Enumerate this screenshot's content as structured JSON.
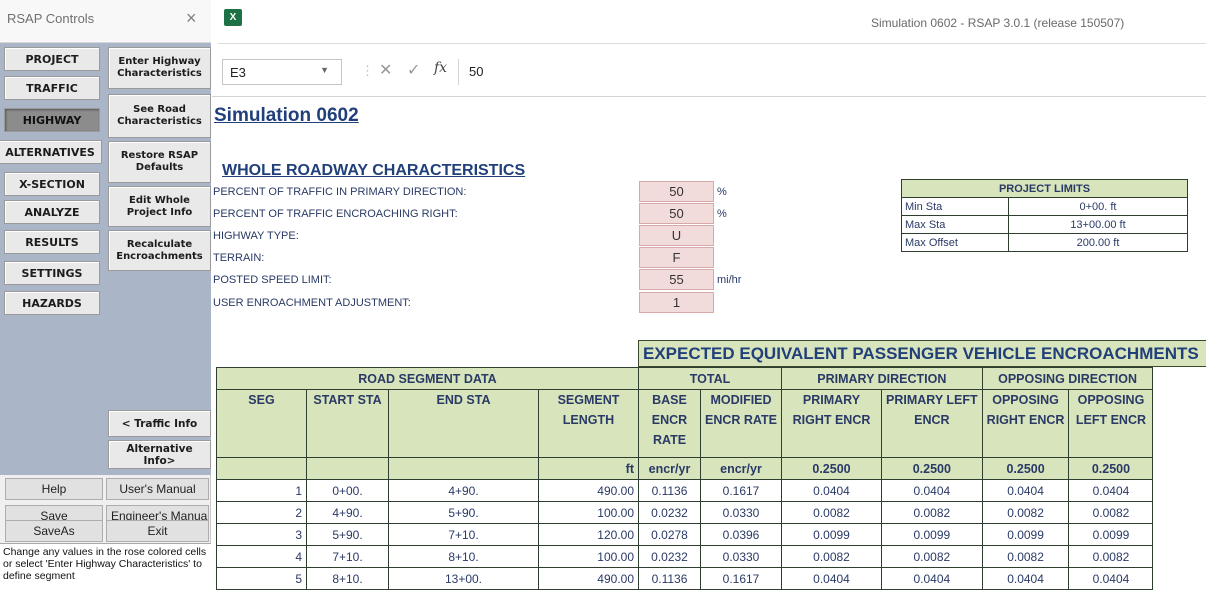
{
  "panel": {
    "title": "RSAP Controls",
    "close": "×",
    "nav": [
      "PROJECT",
      "TRAFFIC",
      "HIGHWAY",
      "ALTERNATIVES",
      "X-SECTION",
      "ANALYZE",
      "RESULTS",
      "SETTINGS",
      "HAZARDS"
    ],
    "active_nav": "HIGHWAY",
    "commands": [
      "Enter Highway Characteristics",
      "See Road Characteristics",
      "Restore RSAP Defaults",
      "Edit Whole Project Info",
      "Recalculate Encroachments"
    ],
    "prev_button": "< Traffic Info",
    "next_button": "Alternative Info>",
    "bottom": {
      "help": "Help",
      "users_manual": "User's Manual",
      "save": "Save",
      "engineers_manual": "Engineer's Manua",
      "saveas": "SaveAs",
      "exit": "Exit"
    },
    "hint": "Change any values in the rose colored cells or select 'Enter Highway Characteristics' to define segment"
  },
  "excel": {
    "app_icon": "excel-icon",
    "window_title": "Simulation 0602 - RSAP 3.0.1 (release 150507)",
    "name_box": "E3",
    "formula_value": "50"
  },
  "sheet": {
    "title": "Simulation 0602",
    "section": "WHOLE ROADWAY CHARACTERISTICS",
    "fields": [
      {
        "label": "PERCENT OF TRAFFIC IN PRIMARY DIRECTION:",
        "value": "50",
        "unit": "%"
      },
      {
        "label": "PERCENT OF TRAFFIC ENCROACHING RIGHT:",
        "value": "50",
        "unit": "%"
      },
      {
        "label": "HIGHWAY TYPE:",
        "value": "U",
        "unit": ""
      },
      {
        "label": "TERRAIN:",
        "value": "F",
        "unit": ""
      },
      {
        "label": "POSTED SPEED LIMIT:",
        "value": "55",
        "unit": "mi/hr"
      },
      {
        "label": "USER ENROACHMENT ADJUSTMENT:",
        "value": "1",
        "unit": ""
      }
    ],
    "limits": {
      "header": "PROJECT LIMITS",
      "rows": [
        {
          "label": "Min Sta",
          "value": "0+00. ft"
        },
        {
          "label": "Max Sta",
          "value": "13+00.00 ft"
        },
        {
          "label": "Max Offset",
          "value": "200.00 ft"
        }
      ]
    },
    "banner": "EXPECTED EQUIVALENT PASSENGER VEHICLE ENCROACHMENTS",
    "groups": [
      "ROAD SEGMENT DATA",
      "TOTAL",
      "PRIMARY DIRECTION",
      "OPPOSING DIRECTION"
    ],
    "columns": [
      [
        "SEG"
      ],
      [
        "START STA"
      ],
      [
        "END STA"
      ],
      [
        "SEGMENT",
        "LENGTH"
      ],
      [
        "BASE",
        "ENCR",
        "RATE"
      ],
      [
        "MODIFIED",
        "ENCR RATE"
      ],
      [
        "PRIMARY",
        "RIGHT ENCR"
      ],
      [
        "PRIMARY LEFT",
        "ENCR"
      ],
      [
        "OPPOSING",
        "RIGHT ENCR"
      ],
      [
        "OPPOSING",
        "LEFT  ENCR"
      ]
    ],
    "units": [
      "",
      "",
      "",
      "ft",
      "encr/yr",
      "encr/yr",
      "0.2500",
      "0.2500",
      "0.2500",
      "0.2500"
    ],
    "rows": [
      [
        "1",
        "0+00.",
        "4+90.",
        "490.00",
        "0.1136",
        "0.1617",
        "0.0404",
        "0.0404",
        "0.0404",
        "0.0404"
      ],
      [
        "2",
        "4+90.",
        "5+90.",
        "100.00",
        "0.0232",
        "0.0330",
        "0.0082",
        "0.0082",
        "0.0082",
        "0.0082"
      ],
      [
        "3",
        "5+90.",
        "7+10.",
        "120.00",
        "0.0278",
        "0.0396",
        "0.0099",
        "0.0099",
        "0.0099",
        "0.0099"
      ],
      [
        "4",
        "7+10.",
        "8+10.",
        "100.00",
        "0.0232",
        "0.0330",
        "0.0082",
        "0.0082",
        "0.0082",
        "0.0082"
      ],
      [
        "5",
        "8+10.",
        "13+00.",
        "490.00",
        "0.1136",
        "0.1617",
        "0.0404",
        "0.0404",
        "0.0404",
        "0.0404"
      ]
    ]
  }
}
